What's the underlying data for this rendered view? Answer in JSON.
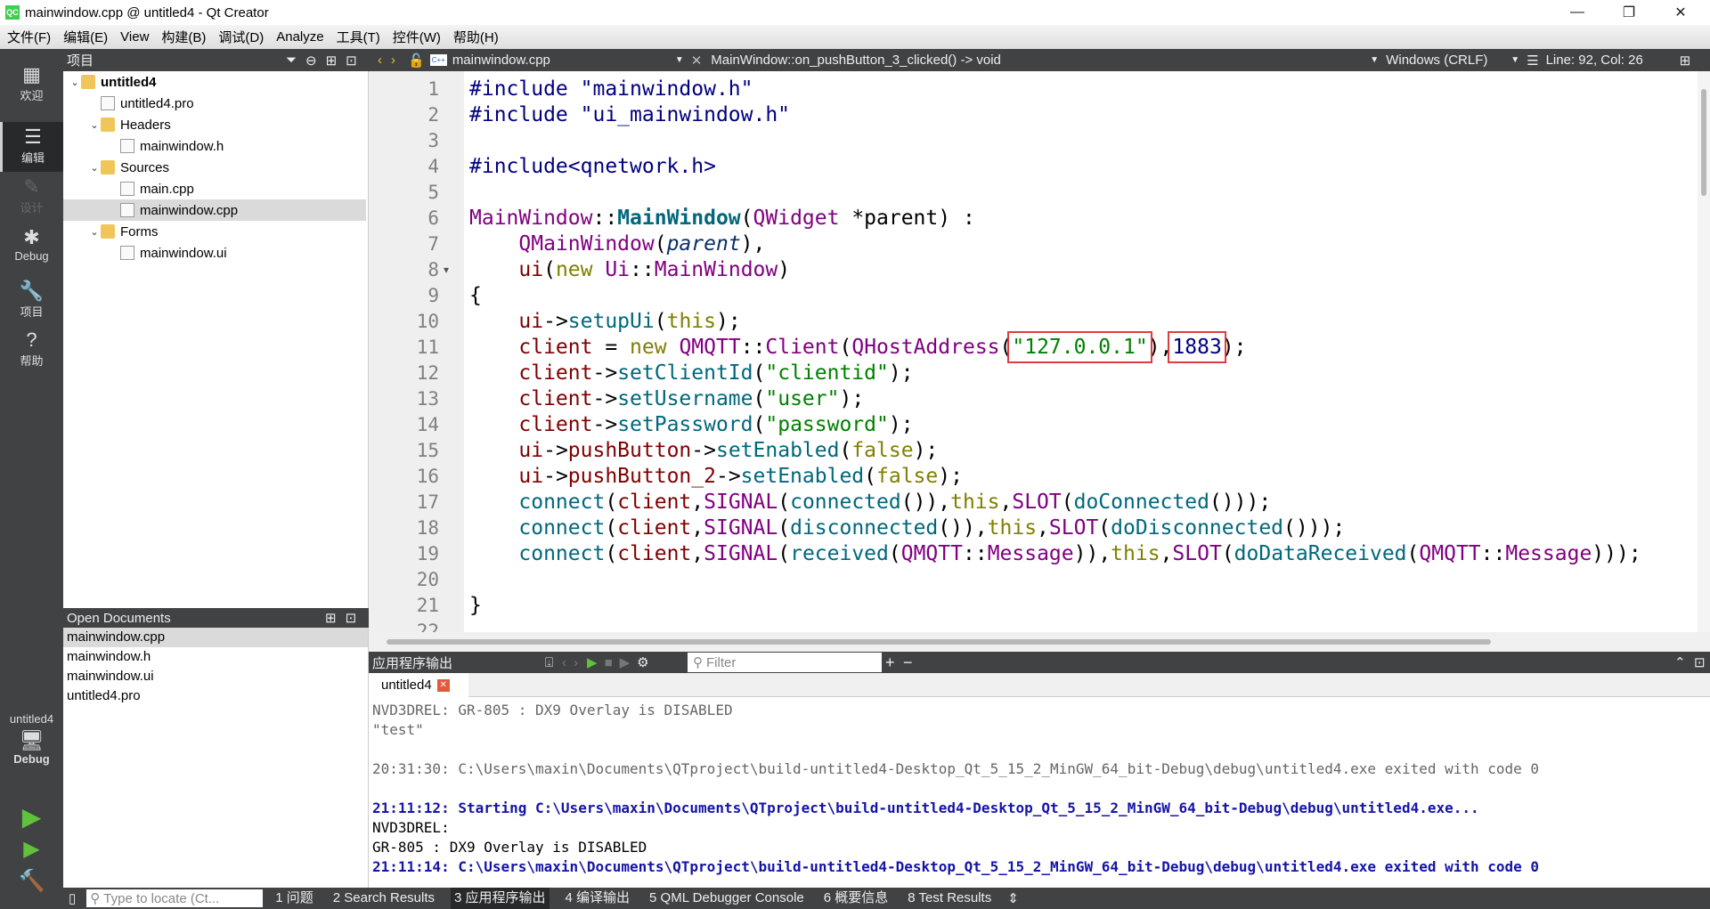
{
  "window": {
    "title": "mainwindow.cpp @ untitled4 - Qt Creator",
    "minimize": "—",
    "maximize": "❐",
    "close": "✕"
  },
  "menu": [
    "文件(F)",
    "编辑(E)",
    "View",
    "构建(B)",
    "调试(D)",
    "Analyze",
    "工具(T)",
    "控件(W)",
    "帮助(H)"
  ],
  "modes": [
    {
      "label": "欢迎",
      "icon": "▦"
    },
    {
      "label": "编辑",
      "icon": "☰"
    },
    {
      "label": "设计",
      "icon": "✎"
    },
    {
      "label": "Debug",
      "icon": "✱"
    },
    {
      "label": "项目",
      "icon": "🔧"
    },
    {
      "label": "帮助",
      "icon": "?"
    }
  ],
  "kit": {
    "project": "untitled4",
    "mode": "Debug"
  },
  "project_panel": {
    "title": "项目",
    "tree": [
      {
        "label": "untitled4",
        "level": 0,
        "expanded": true,
        "bold": true,
        "icon": "project-folder"
      },
      {
        "label": "untitled4.pro",
        "level": 1,
        "icon": "pro-file"
      },
      {
        "label": "Headers",
        "level": 1,
        "expanded": true,
        "icon": "folder"
      },
      {
        "label": "mainwindow.h",
        "level": 2,
        "icon": "header-file"
      },
      {
        "label": "Sources",
        "level": 1,
        "expanded": true,
        "icon": "folder"
      },
      {
        "label": "main.cpp",
        "level": 2,
        "icon": "cpp-file"
      },
      {
        "label": "mainwindow.cpp",
        "level": 2,
        "icon": "cpp-file",
        "selected": true
      },
      {
        "label": "Forms",
        "level": 1,
        "expanded": true,
        "icon": "folder"
      },
      {
        "label": "mainwindow.ui",
        "level": 2,
        "icon": "ui-file"
      }
    ]
  },
  "open_documents": {
    "title": "Open Documents",
    "items": [
      "mainwindow.cpp",
      "mainwindow.h",
      "mainwindow.ui",
      "untitled4.pro"
    ]
  },
  "editor": {
    "file": "mainwindow.cpp",
    "symbol": "MainWindow::on_pushButton_3_clicked() -> void",
    "line_ending": "Windows (CRLF)",
    "position": "Line: 92, Col: 26"
  },
  "code_lines": [
    [
      [
        "#include \"mainwindow.h\"",
        "num"
      ]
    ],
    [
      [
        "#include \"ui_mainwindow.h\"",
        "num"
      ]
    ],
    [],
    [
      [
        "#include<qnetwork.h>",
        "num"
      ]
    ],
    [],
    [
      [
        "MainWindow",
        "ty"
      ],
      [
        "::",
        ""
      ],
      [
        "MainWindow",
        "fnb"
      ],
      [
        "(",
        ""
      ],
      [
        "QWidget",
        "ty"
      ],
      [
        " *parent) :",
        ""
      ]
    ],
    [
      [
        "    ",
        ""
      ],
      [
        "QMainWindow",
        "ty"
      ],
      [
        "(",
        ""
      ],
      [
        "parent",
        "it"
      ],
      [
        "),",
        ""
      ]
    ],
    [
      [
        "    ",
        ""
      ],
      [
        "ui",
        "mem"
      ],
      [
        "(",
        ""
      ],
      [
        "new",
        "kw"
      ],
      [
        " ",
        ""
      ],
      [
        "Ui",
        "ty"
      ],
      [
        "::",
        ""
      ],
      [
        "MainWindow",
        "ty"
      ],
      [
        ")",
        ""
      ]
    ],
    [
      [
        "{",
        ""
      ]
    ],
    [
      [
        "    ",
        ""
      ],
      [
        "ui",
        "mem"
      ],
      [
        "->",
        ""
      ],
      [
        "setupUi",
        "fn"
      ],
      [
        "(",
        ""
      ],
      [
        "this",
        "kw"
      ],
      [
        ");",
        ""
      ]
    ],
    [
      [
        "    ",
        ""
      ],
      [
        "client",
        "mem"
      ],
      [
        " = ",
        ""
      ],
      [
        "new",
        "kw"
      ],
      [
        " ",
        ""
      ],
      [
        "QMQTT",
        "ty"
      ],
      [
        "::",
        ""
      ],
      [
        "Client",
        "ty"
      ],
      [
        "(",
        ""
      ],
      [
        "QHostAddress",
        "ty"
      ],
      [
        "(",
        ""
      ],
      [
        "\"127.0.0.1\"",
        "str box"
      ],
      [
        "),",
        ""
      ],
      [
        "1883",
        "num box"
      ],
      [
        ");",
        ""
      ]
    ],
    [
      [
        "    ",
        ""
      ],
      [
        "client",
        "mem"
      ],
      [
        "->",
        ""
      ],
      [
        "setClientId",
        "fn"
      ],
      [
        "(",
        ""
      ],
      [
        "\"clientid\"",
        "str"
      ],
      [
        ");",
        ""
      ]
    ],
    [
      [
        "    ",
        ""
      ],
      [
        "client",
        "mem"
      ],
      [
        "->",
        ""
      ],
      [
        "setUsername",
        "fn"
      ],
      [
        "(",
        ""
      ],
      [
        "\"user\"",
        "str"
      ],
      [
        ");",
        ""
      ]
    ],
    [
      [
        "    ",
        ""
      ],
      [
        "client",
        "mem"
      ],
      [
        "->",
        ""
      ],
      [
        "setPassword",
        "fn"
      ],
      [
        "(",
        ""
      ],
      [
        "\"password\"",
        "str"
      ],
      [
        ");",
        ""
      ]
    ],
    [
      [
        "    ",
        ""
      ],
      [
        "ui",
        "mem"
      ],
      [
        "->",
        ""
      ],
      [
        "pushButton",
        "mem"
      ],
      [
        "->",
        ""
      ],
      [
        "setEnabled",
        "fn"
      ],
      [
        "(",
        ""
      ],
      [
        "false",
        "kw"
      ],
      [
        ");",
        ""
      ]
    ],
    [
      [
        "    ",
        ""
      ],
      [
        "ui",
        "mem"
      ],
      [
        "->",
        ""
      ],
      [
        "pushButton_2",
        "mem"
      ],
      [
        "->",
        ""
      ],
      [
        "setEnabled",
        "fn"
      ],
      [
        "(",
        ""
      ],
      [
        "false",
        "kw"
      ],
      [
        ");",
        ""
      ]
    ],
    [
      [
        "    ",
        ""
      ],
      [
        "connect",
        "fn"
      ],
      [
        "(",
        ""
      ],
      [
        "client",
        "mem"
      ],
      [
        ",",
        ""
      ],
      [
        "SIGNAL",
        "ty"
      ],
      [
        "(",
        ""
      ],
      [
        "connected",
        "fn"
      ],
      [
        "()),",
        ""
      ],
      [
        "this",
        "kw"
      ],
      [
        ",",
        ""
      ],
      [
        "SLOT",
        "ty"
      ],
      [
        "(",
        ""
      ],
      [
        "doConnected",
        "fn"
      ],
      [
        "()));",
        ""
      ]
    ],
    [
      [
        "    ",
        ""
      ],
      [
        "connect",
        "fn"
      ],
      [
        "(",
        ""
      ],
      [
        "client",
        "mem"
      ],
      [
        ",",
        ""
      ],
      [
        "SIGNAL",
        "ty"
      ],
      [
        "(",
        ""
      ],
      [
        "disconnected",
        "fn"
      ],
      [
        "()),",
        ""
      ],
      [
        "this",
        "kw"
      ],
      [
        ",",
        ""
      ],
      [
        "SLOT",
        "ty"
      ],
      [
        "(",
        ""
      ],
      [
        "doDisconnected",
        "fn"
      ],
      [
        "()));",
        ""
      ]
    ],
    [
      [
        "    ",
        ""
      ],
      [
        "connect",
        "fn"
      ],
      [
        "(",
        ""
      ],
      [
        "client",
        "mem"
      ],
      [
        ",",
        ""
      ],
      [
        "SIGNAL",
        "ty"
      ],
      [
        "(",
        ""
      ],
      [
        "received",
        "fn"
      ],
      [
        "(",
        ""
      ],
      [
        "QMQTT",
        "ty"
      ],
      [
        "::",
        ""
      ],
      [
        "Message",
        "ty"
      ],
      [
        ")),",
        ""
      ],
      [
        "this",
        "kw"
      ],
      [
        ",",
        ""
      ],
      [
        "SLOT",
        "ty"
      ],
      [
        "(",
        ""
      ],
      [
        "doDataReceived",
        "fn"
      ],
      [
        "(",
        ""
      ],
      [
        "QMQTT",
        "ty"
      ],
      [
        "::",
        ""
      ],
      [
        "Message",
        "ty"
      ],
      [
        ")));",
        ""
      ]
    ],
    [],
    [
      [
        "}",
        ""
      ]
    ]
  ],
  "output_panel": {
    "title": "应用程序输出",
    "filter_placeholder": "Filter",
    "add": "+",
    "remove": "−",
    "tab": "untitled4",
    "lines": [
      {
        "text": "NVD3DREL: GR-805 : DX9 Overlay is DISABLED",
        "style": "gray"
      },
      {
        "text": "\"test\"",
        "style": "gray"
      },
      {
        "text": "",
        "style": ""
      },
      {
        "text": "20:31:30: C:\\Users\\maxin\\Documents\\QTproject\\build-untitled4-Desktop_Qt_5_15_2_MinGW_64_bit-Debug\\debug\\untitled4.exe exited with code 0",
        "style": "gray"
      },
      {
        "text": "",
        "style": ""
      },
      {
        "text": "21:11:12: Starting C:\\Users\\maxin\\Documents\\QTproject\\build-untitled4-Desktop_Qt_5_15_2_MinGW_64_bit-Debug\\debug\\untitled4.exe...",
        "style": "blue"
      },
      {
        "text": "NVD3DREL:",
        "style": ""
      },
      {
        "text": "GR-805 : DX9 Overlay is DISABLED",
        "style": ""
      },
      {
        "text": "21:11:14: C:\\Users\\maxin\\Documents\\QTproject\\build-untitled4-Desktop_Qt_5_15_2_MinGW_64_bit-Debug\\debug\\untitled4.exe exited with code 0",
        "style": "blue"
      }
    ]
  },
  "statusbar": {
    "locate_placeholder": "Type to locate (Ct...",
    "panes": [
      "1 问题",
      "2 Search Results",
      "3 应用程序输出",
      "4 编译输出",
      "5 QML Debugger Console",
      "6 概要信息",
      "8 Test Results"
    ],
    "active": 2
  }
}
